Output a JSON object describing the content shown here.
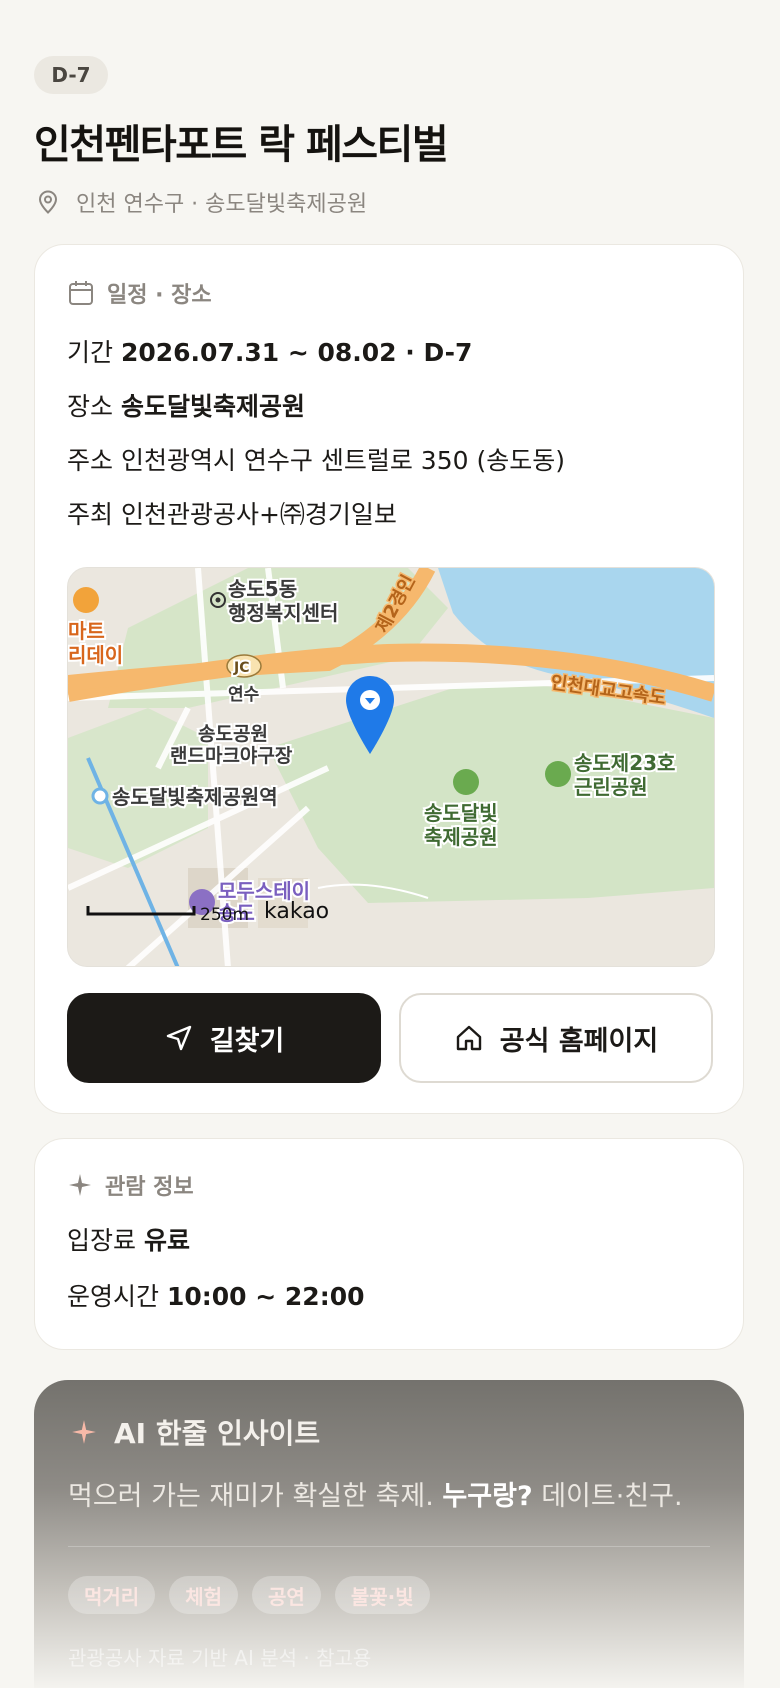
{
  "header": {
    "dday": "D-7",
    "title": "인천펜타포트 락 페스티벌",
    "location": "인천 연수구 · 송도달빛축제공원"
  },
  "schedule": {
    "section_title": "일정 · 장소",
    "period_label": "기간",
    "period_value": "2026.07.31 ~ 08.02 · D-7",
    "venue_label": "장소",
    "venue_value": "송도달빛축제공원",
    "address_label": "주소",
    "address_value": "인천광역시 연수구 센트럴로 350 (송도동)",
    "host_label": "주최",
    "host_value": "인천관광공사+㈜경기일보"
  },
  "map": {
    "labels": {
      "songdo5": "송도5동",
      "office": "행정복지센터",
      "mart1": "마트",
      "mart2": "리데이",
      "jc": "JC",
      "yeonsu": "연수",
      "road2": "제2경인",
      "bridge": "인천대교고속도",
      "park1": "송도공원",
      "park2": "랜드마크야구장",
      "station": "송도달빛축제공원역",
      "fest1": "송도달빛",
      "fest2": "축제공원",
      "near1": "송도제23호",
      "near2": "근린공원",
      "stay1": "모두스테이",
      "stay2": "송도"
    },
    "scale": "250m",
    "provider": "kakao"
  },
  "actions": {
    "directions": "길찾기",
    "homepage": "공식 홈페이지"
  },
  "visit": {
    "section_title": "관람 정보",
    "fee_label": "입장료",
    "fee_value": "유료",
    "hours_label": "운영시간",
    "hours_value": "10:00 ~ 22:00"
  },
  "ai": {
    "title": "AI 한줄 인사이트",
    "text_pre": "먹으러 가는 재미가 확실한 축제. ",
    "text_bold": "누구랑?",
    "text_post": " 데이트·친구.",
    "tags": [
      "먹거리",
      "체험",
      "공연",
      "불꽃·빛"
    ],
    "footer": "관광공사 자료 기반 AI 분석 · 참고용"
  },
  "colors": {
    "background": "#f7f6f2",
    "primary_button": "#1c1a17",
    "map_pin": "#1f7ae8",
    "ai_accent": "#f7b9a8"
  }
}
